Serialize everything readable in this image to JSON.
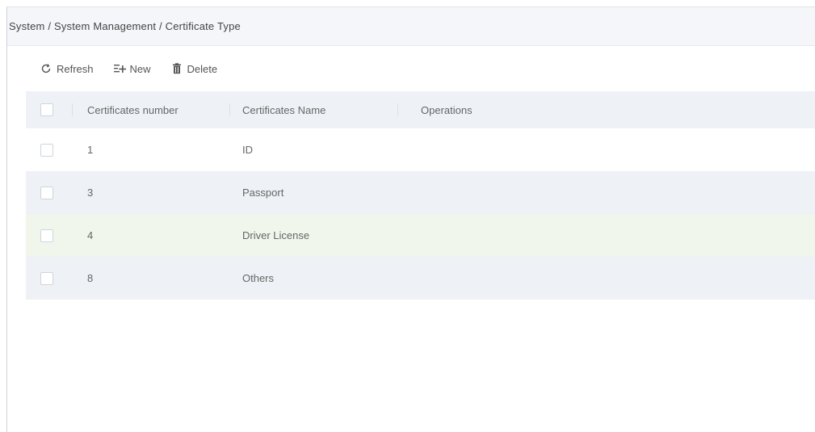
{
  "breadcrumb": "System / System Management / Certificate Type",
  "toolbar": {
    "refresh_label": "Refresh",
    "new_label": "New",
    "delete_label": "Delete"
  },
  "table": {
    "columns": [
      "Certificates number",
      "Certificates Name",
      "Operations"
    ],
    "rows": [
      {
        "number": "1",
        "name": "ID"
      },
      {
        "number": "3",
        "name": "Passport"
      },
      {
        "number": "4",
        "name": "Driver License"
      },
      {
        "number": "8",
        "name": "Others"
      }
    ]
  },
  "colors": {
    "header_bg": "#eef2f7",
    "row_alt_bg": "#eef1f5",
    "row_hover_bg": "#f0f6ec"
  }
}
